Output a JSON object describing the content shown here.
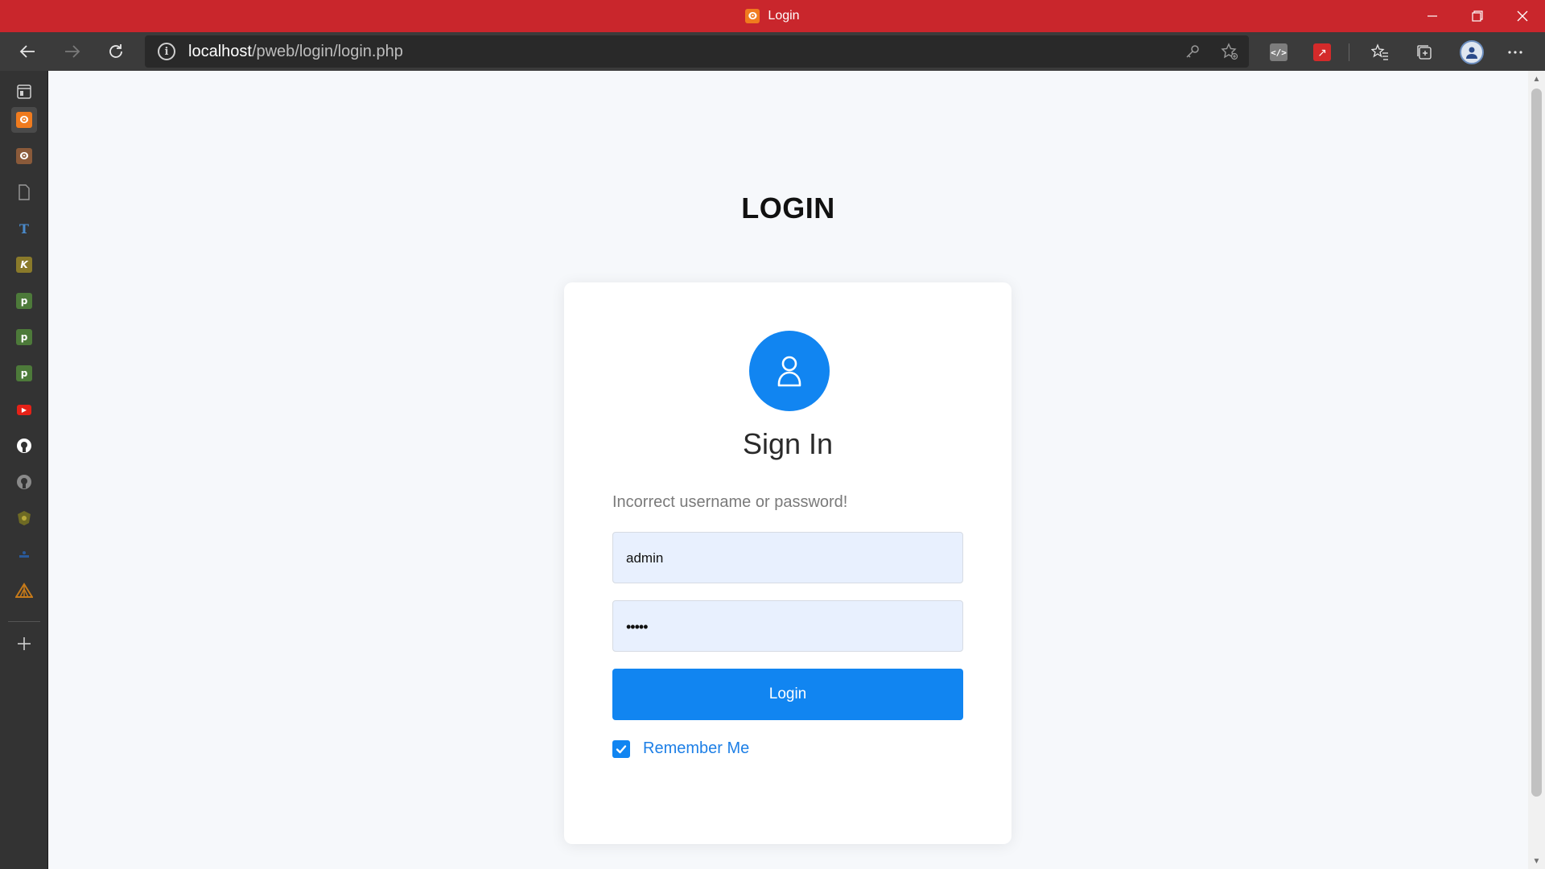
{
  "window": {
    "title": "Login",
    "favicon_letter": "ⵙ",
    "minimize_icon": "minimize-icon",
    "restore_icon": "restore-icon",
    "close_icon": "close-icon"
  },
  "toolbar": {
    "url_host": "localhost",
    "url_path": "/pweb/login/login.php",
    "info_symbol": "i"
  },
  "sidebar": {
    "items": [
      {
        "name": "tab-actions",
        "glyph": "▢",
        "color": "#d0d0d0"
      },
      {
        "name": "xampp-active",
        "glyph": "ⵙ",
        "color": "#f07b1e"
      },
      {
        "name": "xampp",
        "glyph": "ⵙ",
        "color": "#8a5a3a"
      },
      {
        "name": "document",
        "glyph": "▯",
        "color": "#9a9a9a"
      },
      {
        "name": "t-site",
        "glyph": "T",
        "color": "#3c6e9e"
      },
      {
        "name": "k-site",
        "glyph": "K",
        "color": "#8a7a2a"
      },
      {
        "name": "green-1",
        "glyph": "p",
        "color": "#4d7a3a"
      },
      {
        "name": "green-2",
        "glyph": "p",
        "color": "#4d7a3a"
      },
      {
        "name": "green-3",
        "glyph": "p",
        "color": "#4d7a3a"
      },
      {
        "name": "youtube",
        "glyph": "▶",
        "color": "#e62117"
      },
      {
        "name": "github",
        "glyph": "●",
        "color": "#1a1a1a"
      },
      {
        "name": "github-2",
        "glyph": "●",
        "color": "#555555"
      },
      {
        "name": "shield",
        "glyph": "⬢",
        "color": "#7a7a2a"
      },
      {
        "name": "blue-site",
        "glyph": "▬",
        "color": "#2a5a9a"
      },
      {
        "name": "tent",
        "glyph": "▲",
        "color": "#c67a1a"
      }
    ],
    "add_glyph": "+"
  },
  "page": {
    "heading": "LOGIN",
    "card_title": "Sign In",
    "error_message": "Incorrect username or password!",
    "username_value": "admin",
    "password_value": "•••••",
    "login_button": "Login",
    "remember_label": "Remember Me",
    "remember_checked": true,
    "accent": "#1185f1"
  }
}
